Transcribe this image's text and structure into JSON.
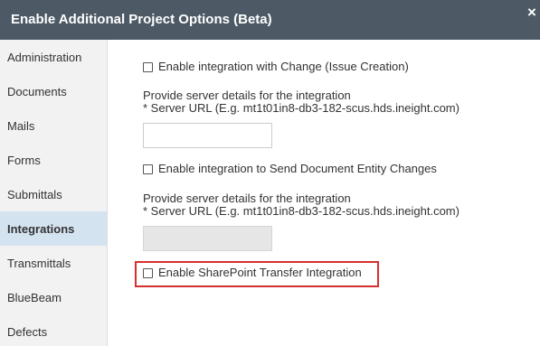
{
  "dialog": {
    "title": "Enable Additional Project Options (Beta)",
    "close_glyph": "×"
  },
  "sidebar": {
    "items": [
      {
        "label": "Administration"
      },
      {
        "label": "Documents"
      },
      {
        "label": "Mails"
      },
      {
        "label": "Forms"
      },
      {
        "label": "Submittals"
      },
      {
        "label": "Integrations",
        "active": true
      },
      {
        "label": "Transmittals"
      },
      {
        "label": "BlueBeam"
      },
      {
        "label": "Defects"
      }
    ]
  },
  "integrations": {
    "change": {
      "checkbox_label": "Enable integration with Change (Issue Creation)",
      "checked": false,
      "server_intro": "Provide server details for the integration",
      "server_hint": "* Server URL (E.g. mt1t01in8-db3-182-scus.hds.ineight.com)",
      "server_url": ""
    },
    "document_entity": {
      "checkbox_label": "Enable integration to Send Document Entity Changes",
      "checked": false,
      "server_intro": "Provide server details for the integration",
      "server_hint": "* Server URL (E.g. mt1t01in8-db3-182-scus.hds.ineight.com)",
      "server_url": "",
      "disabled": true
    },
    "sharepoint": {
      "checkbox_label": "Enable SharePoint Transfer Integration",
      "checked": false,
      "highlighted": true
    }
  },
  "colors": {
    "titlebar": "#4d5a66",
    "sidebar_bg": "#f2f2f2",
    "active_item": "#d4e3f0",
    "highlight_border": "#d62f2f"
  }
}
